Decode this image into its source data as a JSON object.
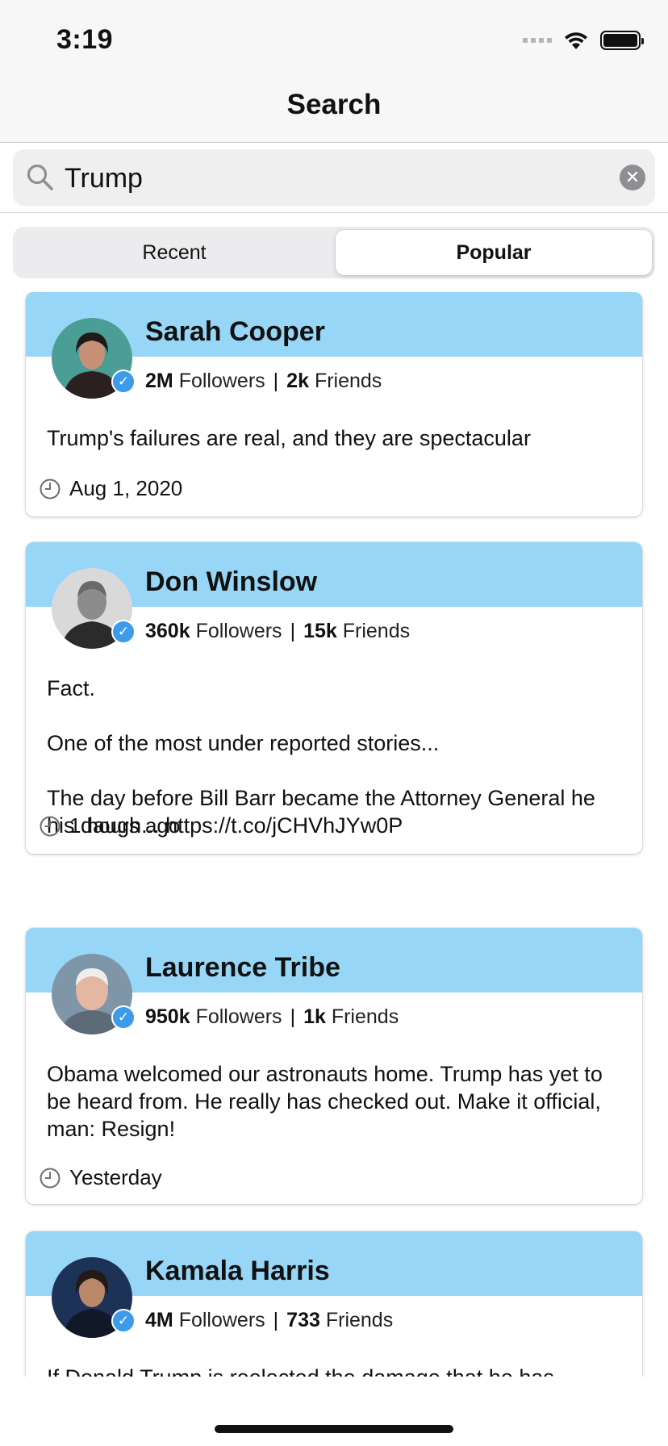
{
  "status_bar": {
    "time": "3:19"
  },
  "nav": {
    "title": "Search"
  },
  "search": {
    "query": "Trump",
    "placeholder": ""
  },
  "segments": {
    "recent": "Recent",
    "popular": "Popular",
    "selected": "Popular"
  },
  "colors": {
    "card_band": "#97d6f6",
    "verified_badge": "#3d9be9"
  },
  "icons": [
    "search-icon",
    "clear-icon",
    "verified-icon",
    "clock-icon"
  ],
  "feed": [
    {
      "author": "Sarah Cooper",
      "followers": "2M",
      "followers_label": "Followers",
      "friends": "2k",
      "friends_label": "Friends",
      "text": "Trump's failures are real, and they are spectacular",
      "time": "Aug 1, 2020"
    },
    {
      "author": "Don Winslow",
      "followers": "360k",
      "followers_label": "Followers",
      "friends": "15k",
      "friends_label": "Friends",
      "text": "Fact.\n\nOne of the most under reported stories...\n\nThe day before Bill Barr became the Attorney General he his daugh... https://t.co/jCHVhJYw0P",
      "time": "1 hours ago"
    },
    {
      "author": "Laurence Tribe",
      "followers": "950k",
      "followers_label": "Followers",
      "friends": "1k",
      "friends_label": "Friends",
      "text": "Obama welcomed our astronauts home. Trump has yet to be heard from. He really has checked out. Make it official, man: Resign!",
      "time": "Yesterday"
    },
    {
      "author": "Kamala Harris",
      "followers": "4M",
      "followers_label": "Followers",
      "friends": "733",
      "friends_label": "Friends",
      "text": "If Donald Trump is reelected the damage that he has",
      "time": ""
    }
  ]
}
